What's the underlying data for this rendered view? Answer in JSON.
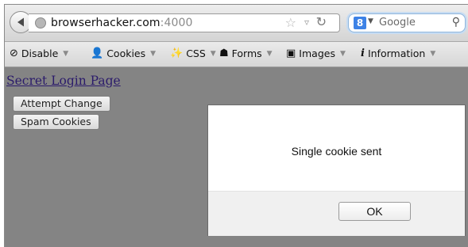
{
  "browser": {
    "url_host": "browserhacker.com",
    "url_port": ":4000",
    "search_placeholder": "Google",
    "search_engine_letter": "8"
  },
  "devbar": {
    "items": [
      {
        "label": "Disable",
        "icon": "no-entry-icon"
      },
      {
        "label": "Cookies",
        "icon": "person-icon"
      },
      {
        "label": "CSS",
        "icon": "wand-icon"
      },
      {
        "label": "Forms",
        "icon": "form-icon"
      },
      {
        "label": "Images",
        "icon": "image-icon"
      },
      {
        "label": "Information",
        "icon": "info-icon"
      }
    ]
  },
  "page": {
    "link_text": "Secret Login Page",
    "buttons": [
      "Attempt Change",
      "Spam Cookies"
    ]
  },
  "dialog": {
    "message": "Single cookie sent",
    "ok_label": "OK"
  }
}
